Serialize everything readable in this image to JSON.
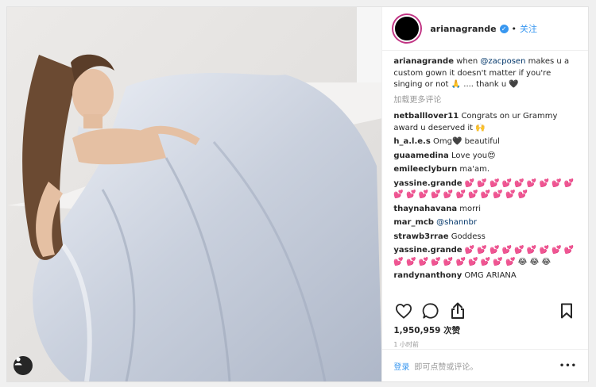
{
  "post": {
    "username": "arianagrande",
    "follow_label": "关注",
    "caption_user": "arianagrande",
    "caption_pre": "when ",
    "caption_mention": "@zacposen",
    "caption_post": " makes u a custom gown it doesn't matter if you're singing or not 🙏 .... thank u 🖤",
    "load_more": "加载更多评论",
    "likes": "1,950,959 次赞",
    "time": "1 小时前"
  },
  "comments": [
    {
      "user": "netballlover11",
      "text": "Congrats on ur Grammy award u deserved it 🙌"
    },
    {
      "user": "h_a.l.e.s",
      "text": "Omg🖤  beautiful"
    },
    {
      "user": "guaamedina",
      "text": "Love you😍"
    },
    {
      "user": "emileeclyburn",
      "text": "ma'am."
    },
    {
      "user": "yassine.grande",
      "text": "💕 💕 💕 💕 💕 💕 💕 💕 💕 💕 💕 💕 💕 💕 💕 💕 💕 💕 💕 💕"
    },
    {
      "user": "thaynahavana",
      "text": "morri"
    },
    {
      "user": "mar_mcb",
      "text": "",
      "mention": "@shannbr"
    },
    {
      "user": "strawb3rrae",
      "text": "Goddess"
    },
    {
      "user": "yassine.grande",
      "text": "💕 💕 💕 💕 💕 💕 💕 💕 💕 💕 💕 💕 💕 💕 💕 💕 💕 💕 💕 😂 😂 😂"
    },
    {
      "user": "randynanthony",
      "text": "OMG ARIANA"
    }
  ],
  "footer": {
    "login": "登录",
    "prompt": "即可点赞或评论。",
    "more": "•••"
  },
  "icons": {
    "like": "heart-icon",
    "comment": "comment-icon",
    "share": "share-icon",
    "save": "bookmark-icon",
    "user": "user-icon"
  },
  "colors": {
    "link": "#3897f0",
    "text": "#262626",
    "muted": "#999999"
  }
}
